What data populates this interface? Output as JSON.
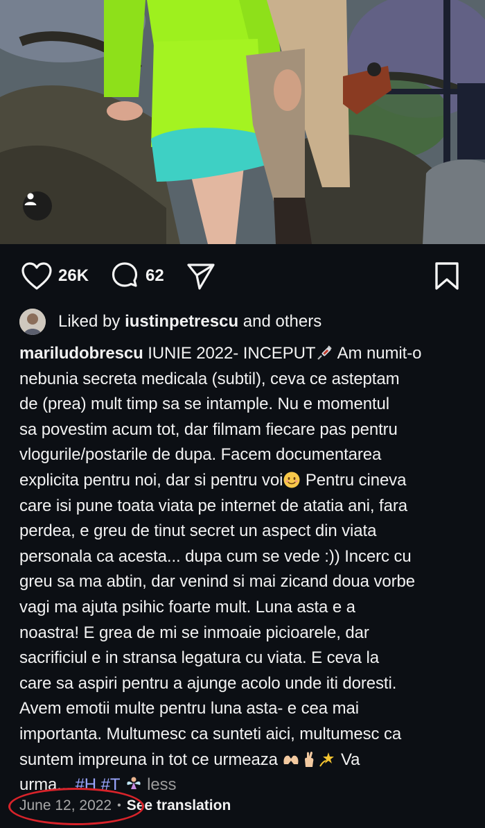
{
  "post": {
    "likes": "26K",
    "comments": "62",
    "liked_by_prefix": "Liked by ",
    "liked_by_user": "iustinpetrescu",
    "liked_by_suffix": " and others",
    "caption_user": "mariludobrescu",
    "caption_lines": [
      " IUNIE 2022- INCEPUT",
      " Am numit-o",
      "nebunia secreta medicala (subtil), ceva ce asteptam",
      "de (prea) mult timp sa se intample. Nu e momentul",
      "sa povestim acum tot, dar filmam fiecare pas pentru",
      "vlogurile/postarile de dupa. Facem documentarea",
      "explicita pentru noi, dar si pentru voi",
      " Pentru cineva",
      "care isi pune toata viata pe internet de atatia ani, fara",
      "perdea, e greu de tinut secret un aspect din viata",
      "personala ca acesta... dupa cum se vede :)) Incerc cu",
      "greu sa ma abtin, dar venind si mai zicand doua vorbe",
      "vagi ma ajuta psihic foarte mult. Luna asta e a",
      "noastra! E grea de mi se inmoaie picioarele, dar",
      "sacrificiul e in stransa legatura cu viata. E ceva la",
      "care sa aspiri pentru a ajunge acolo unde iti doresti.",
      "Avem emotii multe pentru luna asta- e cea mai",
      "importanta. Multumesc ca sunteti aici, multumesc ca",
      "suntem impreuna in tot ce urmeaza",
      " Va",
      "urma... "
    ],
    "hashtags": [
      "#H",
      "#T"
    ],
    "less_label": "less",
    "date": "June 12, 2022",
    "dot": "•",
    "translation_label": "See translation"
  },
  "colors": {
    "background": "#0c0f14",
    "hashtag": "#9aa6ff",
    "annotation_circle": "#d8232a"
  }
}
